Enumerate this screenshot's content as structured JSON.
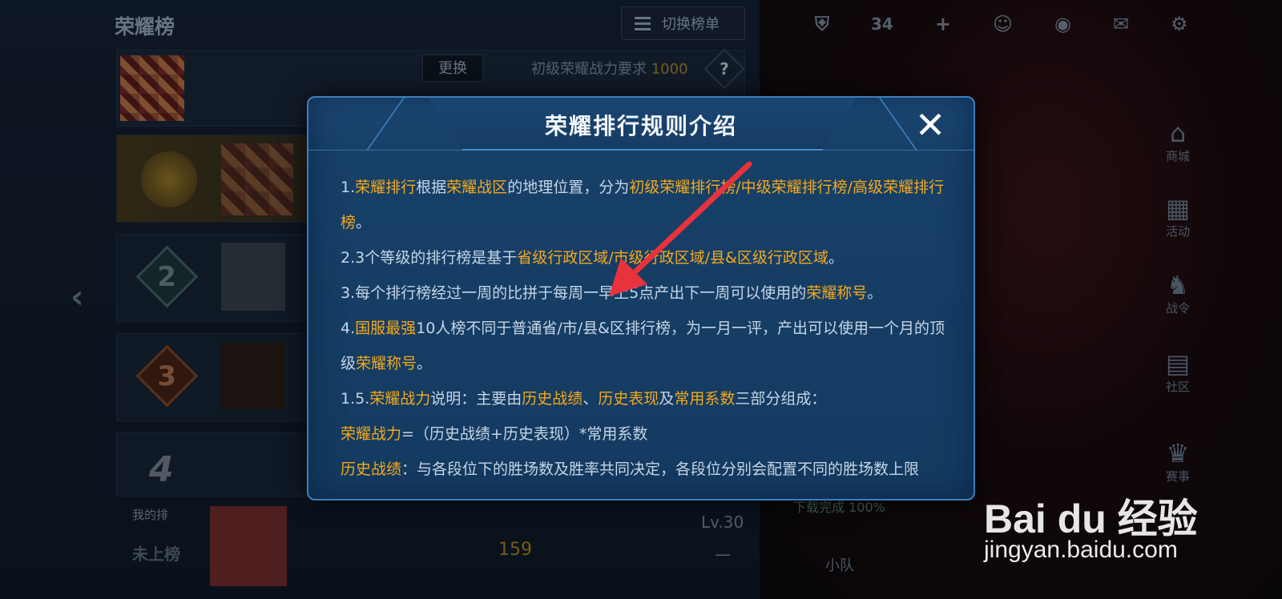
{
  "leaderboard": {
    "title": "荣耀榜",
    "switch_label": "切换榜单",
    "change_label": "更换",
    "requirement_label": "初级荣耀战力要求",
    "requirement_value": "1000",
    "help_glyph": "?",
    "ranks": [
      "2",
      "3",
      "4"
    ],
    "my_rank_label": "我的排",
    "not_ranked": "未上榜",
    "my_score": "159",
    "my_level": "Lv.30",
    "my_dash": "—"
  },
  "hud": {
    "coin_count": "34",
    "side_menu": [
      {
        "label": "商城",
        "icon": "shop-icon"
      },
      {
        "label": "活动",
        "icon": "event-icon"
      },
      {
        "label": "战令",
        "icon": "battlepass-icon"
      },
      {
        "label": "社区",
        "icon": "community-icon"
      },
      {
        "label": "赛事",
        "icon": "trophy-icon"
      }
    ],
    "download_status": "下载完成  100%",
    "team_label": "小队"
  },
  "modal": {
    "title": "荣耀排行规则介绍",
    "close_glyph": "✕",
    "rules": {
      "r1_prefix": "1.",
      "r1_hl1": "荣耀排行",
      "r1_t1": "根据",
      "r1_hl2": "荣耀战区",
      "r1_t2": "的地理位置，分为",
      "r1_hl3": "初级荣耀排行榜/中级荣耀排行榜/高级荣耀排行榜",
      "r1_t3": "。",
      "r2_t1": "2.3个等级的排行榜是基于",
      "r2_hl1": "省级行政区域/市级行政区域/县&区级行政区域",
      "r2_t2": "。",
      "r3_t1": "3.每个排行榜经过一周的比拼于每周一早上5点产出下一周可以使用的",
      "r3_hl1": "荣耀称号",
      "r3_t2": "。",
      "r4_prefix": "4.",
      "r4_hl1": "国服最强",
      "r4_t1": "10人榜不同于普通省/市/县&区排行榜，为一月一评，产出可以使用一个月的顶级",
      "r4_hl2": "荣耀称号",
      "r4_t2": "。",
      "r5_prefix": "1.5.",
      "r5_hl1": "荣耀战力",
      "r5_t1": "说明：主要由",
      "r5_hl2": "历史战绩",
      "r5_t2": "、",
      "r5_hl3": "历史表现",
      "r5_t3": "及",
      "r5_hl4": "常用系数",
      "r5_t4": "三部分组成：",
      "r6_hl1": "荣耀战力",
      "r6_t1": "=（历史战绩+历史表现）*常用系数",
      "r7_hl1": "历史战绩",
      "r7_t1": "：与各段位下的胜场数及胜率共同决定，各段位分别会配置不同的胜场数上限"
    }
  },
  "watermark": {
    "logo": "Bai du 经验",
    "url": "jingyan.baidu.com"
  },
  "colors": {
    "highlight": "#f4a91c",
    "modal_bg": "#174068",
    "annotation_arrow": "#e8323c"
  }
}
